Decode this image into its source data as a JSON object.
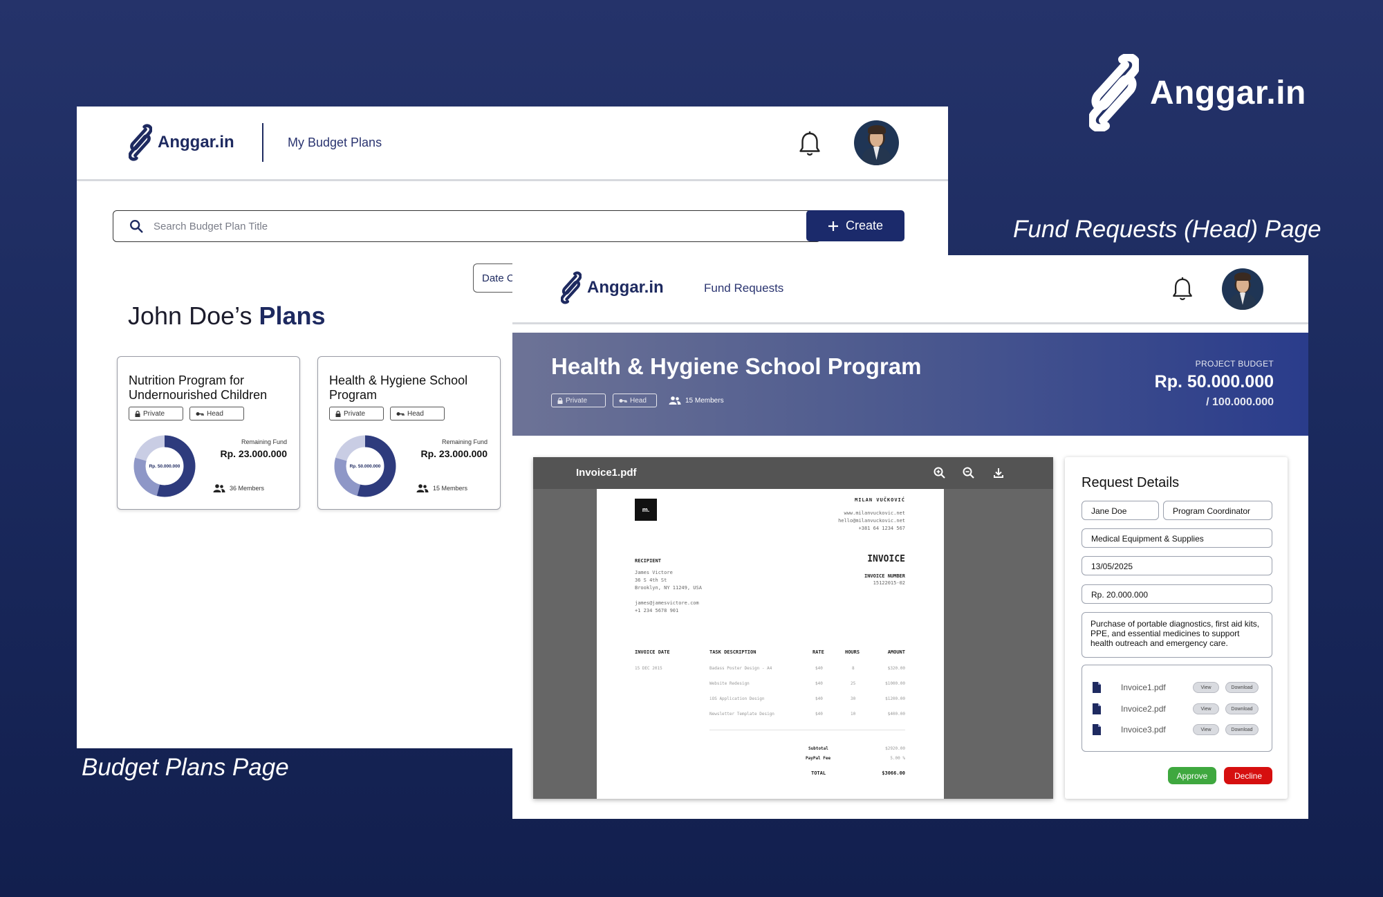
{
  "brand": {
    "name": "Anggar.in"
  },
  "captions": {
    "fund_requests": "Fund Requests (Head) Page",
    "budget_plans": "Budget Plans Page"
  },
  "budget_page": {
    "nav_title": "My Budget Plans",
    "search_placeholder": "Search Budget Plan Title",
    "create_label": "Create",
    "date_filter": "Date C",
    "heading_owner": "John Doe’s",
    "heading_plans": "Plans",
    "cards": [
      {
        "title": "Nutrition Program for Undernourished Children",
        "tag_private": "Private",
        "tag_role": "Head",
        "donut_label": "Rp. 50.000.000",
        "remaining_label": "Remaining Fund",
        "remaining_value": "Rp. 23.000.000",
        "members": "36 Members",
        "remaining_fraction": 0.46
      },
      {
        "title": "Health & Hygiene School Program",
        "tag_private": "Private",
        "tag_role": "Head",
        "donut_label": "Rp. 50.000.000",
        "remaining_label": "Remaining Fund",
        "remaining_value": "Rp. 23.000.000",
        "members": "15 Members",
        "remaining_fraction": 0.46
      }
    ]
  },
  "fund_page": {
    "nav_title": "Fund Requests",
    "program": {
      "title": "Health & Hygiene School Program",
      "tag_private": "Private",
      "tag_role": "Head",
      "members": "15 Members",
      "budget_label": "PROJECT BUDGET",
      "budget_value": "Rp. 50.000.000",
      "budget_total": "/ 100.000.000"
    },
    "viewer": {
      "file_name": "Invoice1.pdf",
      "invoice": {
        "logo": "m.",
        "issuer_name": "MILAN VUČKOVIĆ",
        "issuer_lines": [
          "www.milanvuckovic.net",
          "hello@milanvuckovic.net",
          "+381 64 1234 567"
        ],
        "recipient_label": "RECIPIENT",
        "recipient_lines": [
          "James Victore",
          "36 S 4th St",
          "Brooklyn, NY 11249, USA",
          "",
          "james@jamesvictore.com",
          "+1 234 5678 901"
        ],
        "title": "INVOICE",
        "number_label": "INVOICE NUMBER",
        "number_value": "15122015-02",
        "col_date": "INVOICE DATE",
        "col_task": "TASK DESCRIPTION",
        "col_rate": "RATE",
        "col_hours": "HOURS",
        "col_amount": "AMOUNT",
        "date_value": "15 DEC 2015",
        "rows": [
          {
            "task": "Badass Poster Design - A4",
            "rate": "$40",
            "hours": "8",
            "amount": "$320.00"
          },
          {
            "task": "Website Redesign",
            "rate": "$40",
            "hours": "25",
            "amount": "$1000.00"
          },
          {
            "task": "iOS Application Design",
            "rate": "$40",
            "hours": "30",
            "amount": "$1200.00"
          },
          {
            "task": "Newsletter Template Design",
            "rate": "$40",
            "hours": "10",
            "amount": "$400.00"
          }
        ],
        "subtotal_label": "Subtotal",
        "subtotal_value": "$2920.00",
        "fee_label": "PayPal Fee",
        "fee_value": "5.00 %",
        "total_label": "TOTAL",
        "total_value": "$3066.00"
      }
    },
    "details": {
      "heading": "Request Details",
      "name": "Jane Doe",
      "role": "Program Coordinator",
      "category": "Medical Equipment & Supplies",
      "date": "13/05/2025",
      "amount": "Rp. 20.000.000",
      "description": "Purchase of portable diagnostics, first aid kits, PPE, and essential medicines to support health outreach and emergency care.",
      "files": [
        {
          "name": "Invoice1.pdf",
          "view": "View",
          "download": "Download"
        },
        {
          "name": "Invoice2.pdf",
          "view": "View",
          "download": "Download"
        },
        {
          "name": "Invoice3.pdf",
          "view": "View",
          "download": "Download"
        }
      ],
      "approve_label": "Approve",
      "decline_label": "Decline"
    }
  }
}
